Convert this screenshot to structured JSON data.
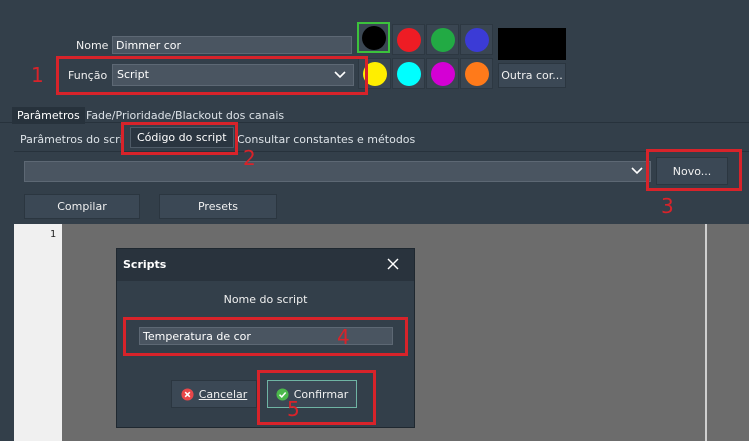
{
  "form": {
    "nome_label": "Nome",
    "nome_value": "Dimmer cor",
    "funcao_label": "Função",
    "funcao_value": "Script"
  },
  "colors": {
    "row1": [
      "#000000",
      "#ee1c24",
      "#22aa44",
      "#3b3bd6"
    ],
    "row2": [
      "#ffee00",
      "#00ffff",
      "#d400d4",
      "#ff7a1a"
    ],
    "selected": "#000000",
    "preview": "#000000",
    "outra_cor_label": "Outra cor..."
  },
  "tabs_main": [
    "Parâmetros",
    "Fade/Prioridade/Blackout dos canais"
  ],
  "tabs_sub": [
    "Parâmetros do script",
    "Código do script",
    "Consultar constantes e métodos"
  ],
  "toolbar": {
    "novo_label": "Novo...",
    "compilar_label": "Compilar",
    "presets_label": "Presets"
  },
  "editor": {
    "line_number": "1"
  },
  "dialog": {
    "title": "Scripts",
    "prompt": "Nome do script",
    "input_value": "Temperatura de cor",
    "cancel_label": "Cancelar",
    "confirm_label": "Confirmar"
  },
  "annotations": [
    "1",
    "2",
    "3",
    "4",
    "5"
  ]
}
